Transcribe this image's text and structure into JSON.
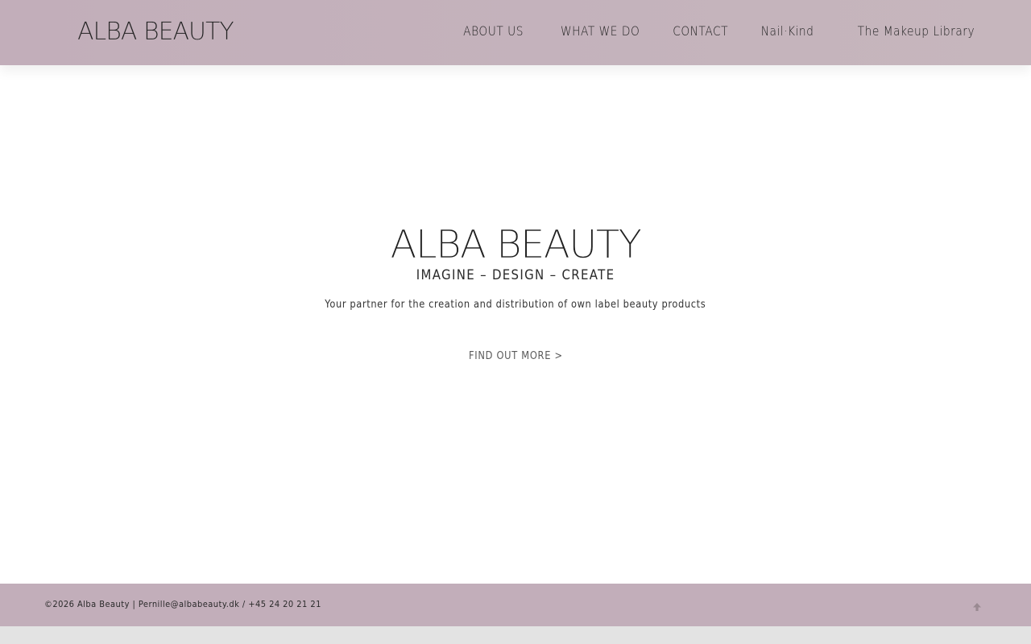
{
  "header": {
    "logo_text": "ALBA BEAUTY",
    "nav": [
      {
        "label": "ABOUT US"
      },
      {
        "label": "WHAT WE DO"
      },
      {
        "label": "CONTACT"
      },
      {
        "label": "Nail·Kind"
      },
      {
        "label": "The Makeup Library"
      }
    ]
  },
  "hero": {
    "title": "ALBA BEAUTY",
    "tagline": "IMAGINE – DESIGN – CREATE",
    "description": "Your partner for the creation and distribution of own label beauty products",
    "cta_label": "FIND OUT MORE >"
  },
  "footer": {
    "copyright": "©2026 Alba Beauty | ",
    "email": "Pernille@albabeauty.dk",
    "separator": " / ",
    "phone": "+45 24 20 21 21",
    "to_top_icon": "arrow-up-icon"
  },
  "colors": {
    "header_bg": "#c2aeba",
    "footer_bg": "#c2aeba",
    "main_bg": "#ffffff",
    "text": "#1f1f1f"
  }
}
